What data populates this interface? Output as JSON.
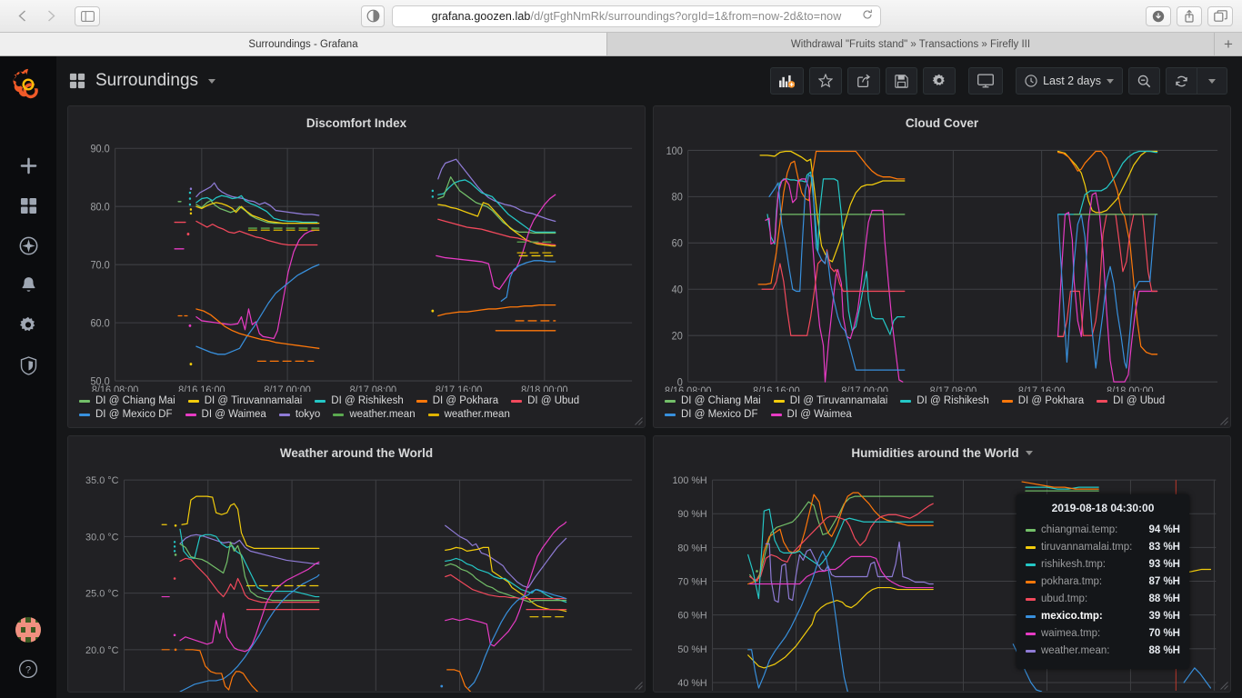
{
  "browser": {
    "back_icon": "chevron-left-icon",
    "forward_icon": "chevron-right-icon",
    "sidebar_icon": "sidebar-toggle-icon",
    "reader_icon": "reader-view-icon",
    "url_host": "grafana.goozen.lab",
    "url_path": "/d/gtFghNmRk/surroundings?orgId=1&from=now-2d&to=now",
    "reload_icon": "reload-icon",
    "download_icon": "download-icon",
    "share_icon": "share-icon",
    "tabs_icon": "show-all-tabs-icon",
    "new_tab_label": "+",
    "tabs": [
      {
        "label": "Surroundings - Grafana",
        "active": true
      },
      {
        "label": "Withdrawal \"Fruits stand\" » Transactions » Firefly III",
        "active": false
      }
    ]
  },
  "sidebar": {
    "logo": "grafana-logo-icon",
    "items": [
      {
        "name": "create",
        "icon": "plus-icon"
      },
      {
        "name": "dashboards",
        "icon": "dashboards-icon"
      },
      {
        "name": "explore",
        "icon": "compass-icon"
      },
      {
        "name": "alerting",
        "icon": "bell-icon"
      },
      {
        "name": "configuration",
        "icon": "gear-icon"
      },
      {
        "name": "server-admin",
        "icon": "shield-icon"
      }
    ],
    "avatar": "user-avatar",
    "help": "help-icon"
  },
  "navbar": {
    "dashboard_icon": "dashboards-icon",
    "title": "Surroundings",
    "actions": [
      {
        "name": "add-panel",
        "icon": "add-panel-icon"
      },
      {
        "name": "mark-favorite",
        "icon": "star-icon"
      },
      {
        "name": "share-dashboard",
        "icon": "share-icon"
      },
      {
        "name": "save-dashboard",
        "icon": "save-icon"
      },
      {
        "name": "dashboard-settings",
        "icon": "gear-icon"
      },
      {
        "name": "cycle-view-mode",
        "icon": "monitor-icon"
      }
    ],
    "time_range": "Last 2 days",
    "time_icon": "clock-icon",
    "zoom_out_icon": "zoom-out-icon",
    "refresh_icon": "refresh-icon",
    "refresh_caret": "chevron-down-icon"
  },
  "colors": {
    "green": "#73bf69",
    "yellow": "#f2cc0c",
    "cyan": "#24c7c6",
    "orange": "#ff780a",
    "red": "#f2495c",
    "blue": "#3890dd",
    "magenta": "#e73bc4",
    "purple": "#8f7bd6"
  },
  "chart_data": [
    {
      "panel": "discomfort-index",
      "type": "line",
      "title": "Discomfort Index",
      "xlabel": "",
      "ylabel": "",
      "ylim": [
        50,
        90
      ],
      "yticks": [
        "50.0",
        "60.0",
        "70.0",
        "80.0",
        "90.0"
      ],
      "xticks": [
        "8/16 08:00",
        "8/16 16:00",
        "8/17 00:00",
        "8/17 08:00",
        "8/17 16:00",
        "8/18 00:00"
      ],
      "grid": true,
      "legend_position": "bottom",
      "series": [
        {
          "name": "DI @ Chiang Mai",
          "color": "#73bf69"
        },
        {
          "name": "DI @ Tiruvannamalai",
          "color": "#f2cc0c"
        },
        {
          "name": "DI @ Rishikesh",
          "color": "#24c7c6"
        },
        {
          "name": "DI @ Pokhara",
          "color": "#ff780a"
        },
        {
          "name": "DI @ Ubud",
          "color": "#f2495c"
        },
        {
          "name": "DI @ Mexico DF",
          "color": "#3890dd"
        },
        {
          "name": "DI @ Waimea",
          "color": "#e73bc4"
        },
        {
          "name": "tokyo",
          "color": "#8f7bd6"
        },
        {
          "name": "weather.mean",
          "color": "#5ba94f"
        },
        {
          "name": "weather.mean",
          "color": "#e0b400"
        }
      ]
    },
    {
      "panel": "cloud-cover",
      "type": "line",
      "title": "Cloud Cover",
      "xlabel": "",
      "ylabel": "",
      "ylim": [
        0,
        100
      ],
      "yticks": [
        "0",
        "20",
        "40",
        "60",
        "80",
        "100"
      ],
      "xticks": [
        "8/16 08:00",
        "8/16 16:00",
        "8/17 00:00",
        "8/17 08:00",
        "8/17 16:00",
        "8/18 00:00"
      ],
      "grid": true,
      "legend_position": "bottom",
      "series": [
        {
          "name": "DI @ Chiang Mai",
          "color": "#73bf69"
        },
        {
          "name": "DI @ Tiruvannamalai",
          "color": "#f2cc0c"
        },
        {
          "name": "DI @ Rishikesh",
          "color": "#24c7c6"
        },
        {
          "name": "DI @ Pokhara",
          "color": "#ff780a"
        },
        {
          "name": "DI @ Ubud",
          "color": "#f2495c"
        },
        {
          "name": "DI @ Mexico DF",
          "color": "#3890dd"
        },
        {
          "name": "DI @ Waimea",
          "color": "#e73bc4"
        }
      ]
    },
    {
      "panel": "weather-around-the-world",
      "type": "line",
      "title": "Weather around the World",
      "xlabel": "",
      "ylabel": "",
      "ylim": [
        17,
        35
      ],
      "yticks": [
        "20.0 °C",
        "25.0 °C",
        "30.0 °C",
        "35.0 °C"
      ],
      "xticks": [],
      "grid": true,
      "legend_position": "hidden",
      "series": [
        {
          "name": "chiangmai.temp",
          "color": "#73bf69"
        },
        {
          "name": "tiruvannamalai.tmp",
          "color": "#f2cc0c"
        },
        {
          "name": "rishikesh.tmp",
          "color": "#24c7c6"
        },
        {
          "name": "pokhara.tmp",
          "color": "#ff780a"
        },
        {
          "name": "ubud.tmp",
          "color": "#f2495c"
        },
        {
          "name": "mexico.tmp",
          "color": "#3890dd"
        },
        {
          "name": "waimea.tmp",
          "color": "#e73bc4"
        },
        {
          "name": "weather.mean",
          "color": "#8f7bd6"
        }
      ]
    },
    {
      "panel": "humidities-around-the-world",
      "type": "line",
      "title": "Humidities around the World",
      "xlabel": "",
      "ylabel": "",
      "ylim": [
        38,
        100
      ],
      "yticks": [
        "40 %H",
        "50 %H",
        "60 %H",
        "70 %H",
        "80 %H",
        "90 %H",
        "100 %H"
      ],
      "xticks": [],
      "grid": true,
      "legend_position": "hidden",
      "series": [
        {
          "name": "chiangmai.temp",
          "color": "#73bf69"
        },
        {
          "name": "tiruvannamalai.tmp",
          "color": "#f2cc0c"
        },
        {
          "name": "rishikesh.tmp",
          "color": "#24c7c6"
        },
        {
          "name": "pokhara.tmp",
          "color": "#ff780a"
        },
        {
          "name": "ubud.tmp",
          "color": "#f2495c"
        },
        {
          "name": "mexico.tmp",
          "color": "#3890dd"
        },
        {
          "name": "waimea.tmp",
          "color": "#e73bc4"
        },
        {
          "name": "weather.mean",
          "color": "#8f7bd6"
        }
      ]
    }
  ],
  "panels": {
    "discomfort": {
      "title": "Discomfort Index"
    },
    "cloud": {
      "title": "Cloud Cover"
    },
    "weather": {
      "title": "Weather around the World"
    },
    "humidity": {
      "title": "Humidities around the World",
      "menu_icon": "chevron-down-icon"
    }
  },
  "tooltip": {
    "time": "2019-08-18 04:30:00",
    "rows": [
      {
        "name": "chiangmai.temp:",
        "value": "94 %H",
        "color": "#73bf69",
        "highlight": false
      },
      {
        "name": "tiruvannamalai.tmp:",
        "value": "83 %H",
        "color": "#f2cc0c",
        "highlight": false
      },
      {
        "name": "rishikesh.tmp:",
        "value": "93 %H",
        "color": "#24c7c6",
        "highlight": false
      },
      {
        "name": "pokhara.tmp:",
        "value": "87 %H",
        "color": "#ff780a",
        "highlight": false
      },
      {
        "name": "ubud.tmp:",
        "value": "88 %H",
        "color": "#f2495c",
        "highlight": false
      },
      {
        "name": "mexico.tmp:",
        "value": "39 %H",
        "color": "#3890dd",
        "highlight": true
      },
      {
        "name": "waimea.tmp:",
        "value": "70 %H",
        "color": "#e73bc4",
        "highlight": false
      },
      {
        "name": "weather.mean:",
        "value": "88 %H",
        "color": "#8f7bd6",
        "highlight": false
      }
    ]
  }
}
